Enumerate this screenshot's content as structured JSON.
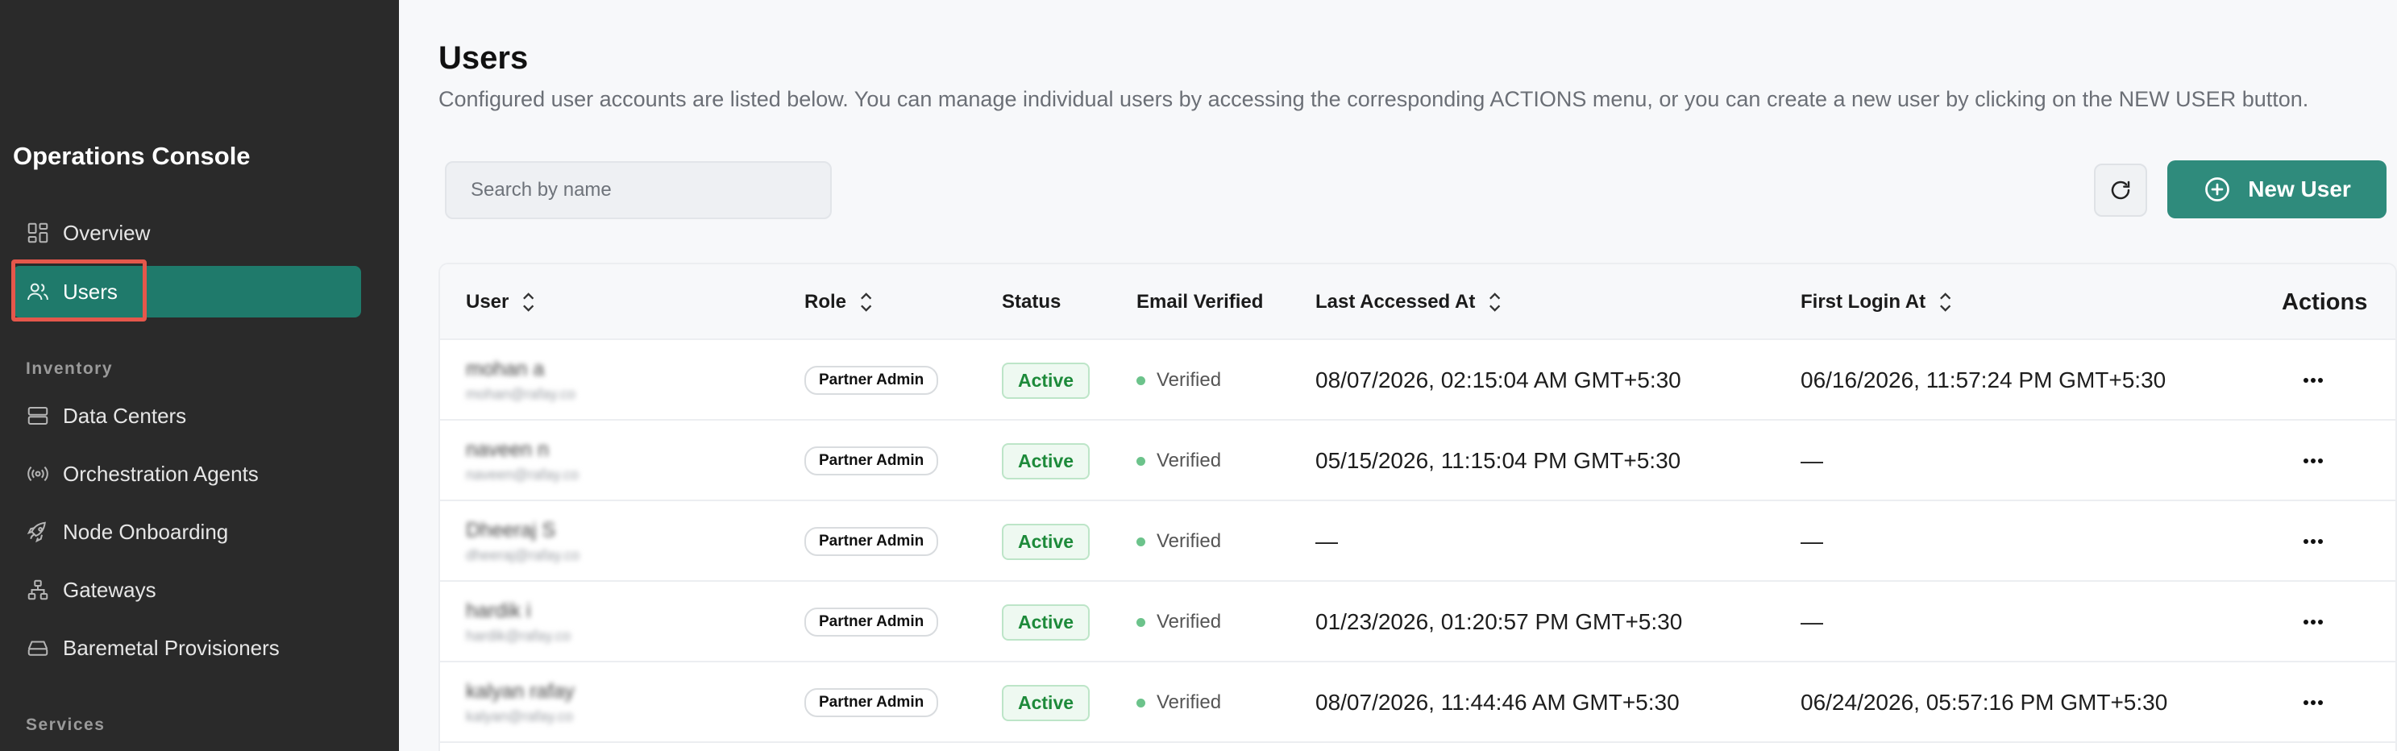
{
  "sidebar": {
    "brand": "Operations Console",
    "items_top": [
      {
        "label": "Overview",
        "icon": "grid-icon"
      },
      {
        "label": "Users",
        "icon": "users-icon",
        "active": true
      }
    ],
    "sections": [
      {
        "label": "Inventory",
        "items": [
          {
            "label": "Data Centers",
            "icon": "server-icon"
          },
          {
            "label": "Orchestration Agents",
            "icon": "broadcast-icon"
          },
          {
            "label": "Node Onboarding",
            "icon": "rocket-icon"
          },
          {
            "label": "Gateways",
            "icon": "network-icon"
          },
          {
            "label": "Baremetal Provisioners",
            "icon": "hard-drive-icon"
          }
        ]
      },
      {
        "label": "Services",
        "items": []
      }
    ]
  },
  "header": {
    "title": "Users",
    "description": "Configured user accounts are listed below. You can manage individual users by accessing the corresponding ACTIONS menu, or you can create a new user by clicking on the NEW USER button."
  },
  "toolbar": {
    "search_placeholder": "Search by name",
    "refresh_icon": "refresh-icon",
    "new_user_label": "New User",
    "new_user_icon": "plus-circle-icon"
  },
  "table": {
    "columns": [
      "User",
      "Role",
      "Status",
      "Email Verified",
      "Last Accessed At",
      "First Login At",
      "Actions"
    ],
    "rows": [
      {
        "name": "mohan a",
        "email": "mohan@rafay.co",
        "role": "Partner Admin",
        "status": "Active",
        "verified": "Verified",
        "last_accessed": "08/07/2026, 02:15:04 AM GMT+5:30",
        "first_login": "06/16/2026, 11:57:24 PM GMT+5:30"
      },
      {
        "name": "naveen n",
        "email": "naveen@rafay.co",
        "role": "Partner Admin",
        "status": "Active",
        "verified": "Verified",
        "last_accessed": "05/15/2026, 11:15:04 PM GMT+5:30",
        "first_login": "—"
      },
      {
        "name": "Dheeraj S",
        "email": "dheeraj@rafay.co",
        "role": "Partner Admin",
        "status": "Active",
        "verified": "Verified",
        "last_accessed": "—",
        "first_login": "—"
      },
      {
        "name": "hardik i",
        "email": "hardik@rafay.co",
        "role": "Partner Admin",
        "status": "Active",
        "verified": "Verified",
        "last_accessed": "01/23/2026, 01:20:57 PM GMT+5:30",
        "first_login": "—"
      },
      {
        "name": "kalyan rafay",
        "email": "kalyan@rafay.co",
        "role": "Partner Admin",
        "status": "Active",
        "verified": "Verified",
        "last_accessed": "08/07/2026, 11:44:46 AM GMT+5:30",
        "first_login": "06/24/2026, 05:57:16 PM GMT+5:30"
      }
    ]
  },
  "colors": {
    "sidebar_bg": "#2a2a2a",
    "accent": "#2f8b7c",
    "active_nav": "#1f7a6b",
    "status_green": "#1d8a3a",
    "highlight_red": "#e5574b"
  }
}
